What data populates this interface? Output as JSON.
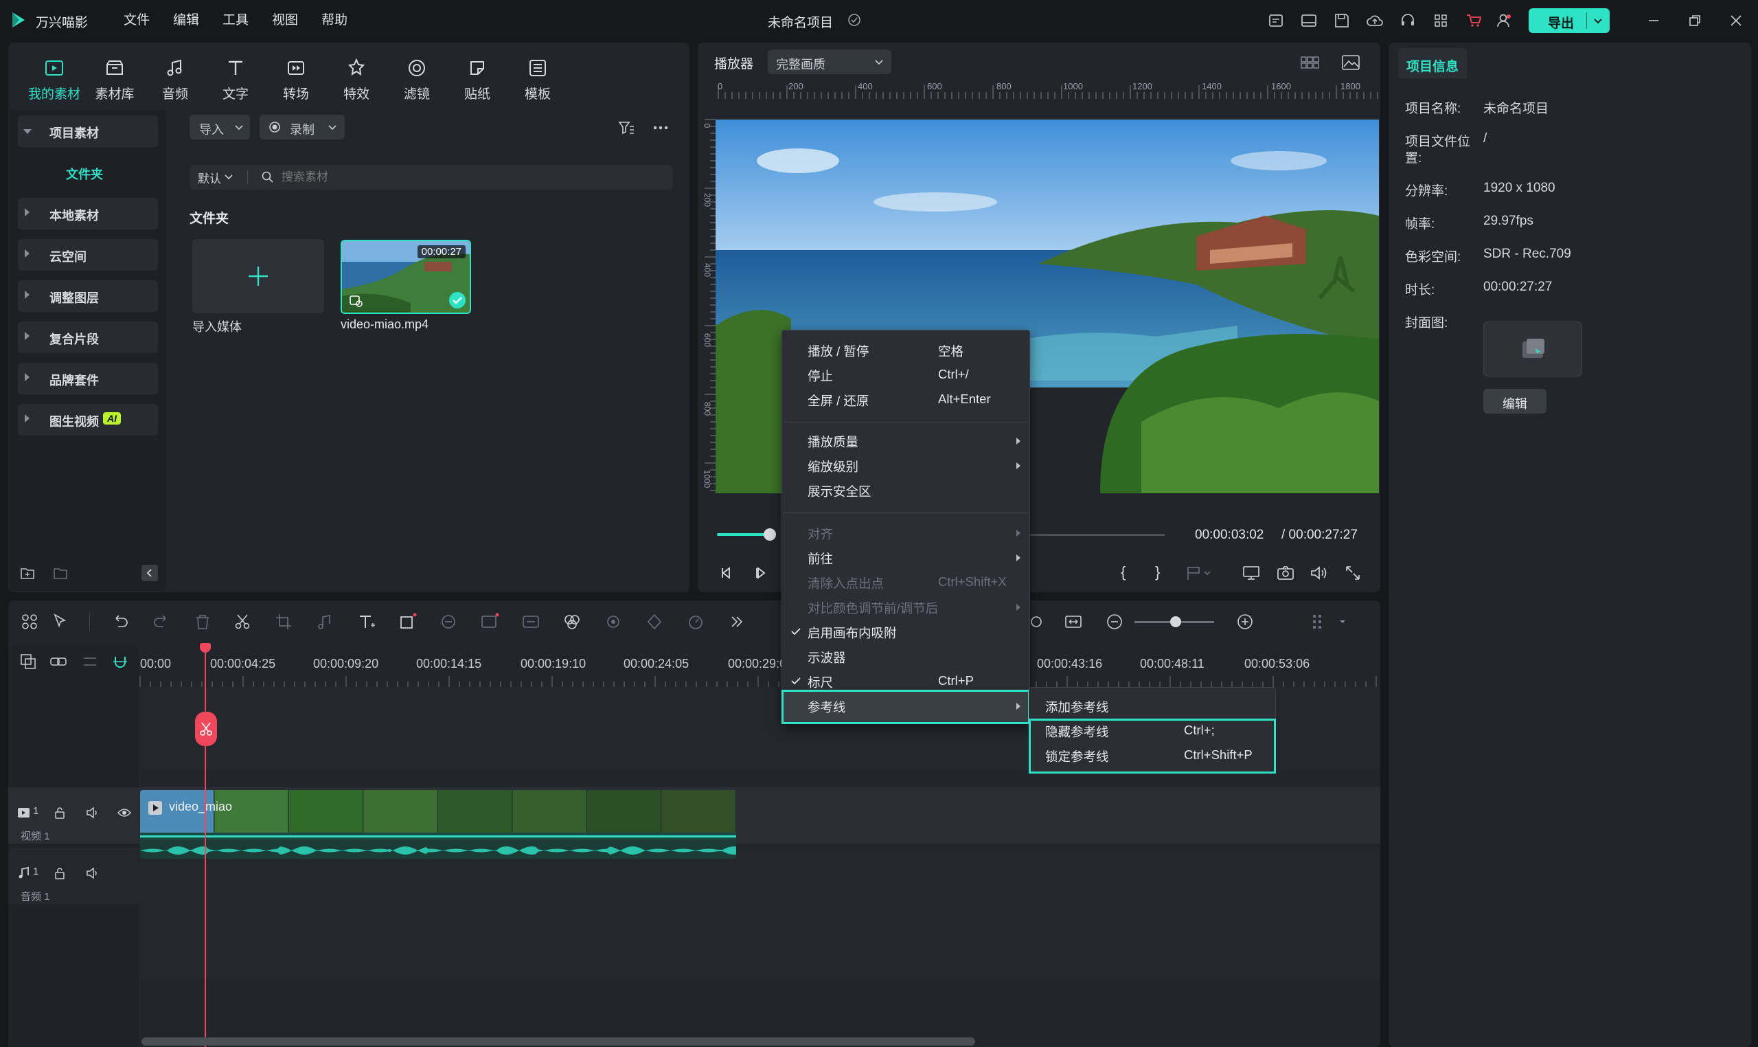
{
  "app": {
    "name": "万兴喵影",
    "project_title": "未命名项目",
    "export_label": "导出"
  },
  "menubar": [
    "文件",
    "编辑",
    "工具",
    "视图",
    "帮助"
  ],
  "toolbar_tabs": [
    {
      "label": "我的素材",
      "icon": "media-icon",
      "active": true
    },
    {
      "label": "素材库",
      "icon": "library-icon"
    },
    {
      "label": "音频",
      "icon": "music-icon"
    },
    {
      "label": "文字",
      "icon": "text-icon"
    },
    {
      "label": "转场",
      "icon": "transition-icon"
    },
    {
      "label": "特效",
      "icon": "effects-icon"
    },
    {
      "label": "滤镜",
      "icon": "filter-icon"
    },
    {
      "label": "贴纸",
      "icon": "sticker-icon"
    },
    {
      "label": "模板",
      "icon": "template-icon"
    }
  ],
  "sidebar": {
    "items": [
      {
        "label": "项目素材",
        "expanded": true
      },
      {
        "label": "文件夹",
        "sub": true
      },
      {
        "label": "本地素材"
      },
      {
        "label": "云空间"
      },
      {
        "label": "调整图层"
      },
      {
        "label": "复合片段"
      },
      {
        "label": "品牌套件"
      },
      {
        "label": "图生视频",
        "badge": "AI"
      }
    ]
  },
  "media": {
    "import_label": "导入",
    "record_label": "录制",
    "sort_label": "默认",
    "search_placeholder": "搜索素材",
    "folder_heading": "文件夹",
    "import_tile_label": "导入媒体",
    "clip_name": "video-miao.mp4",
    "clip_duration": "00:00:27"
  },
  "player": {
    "label": "播放器",
    "quality": "完整画质",
    "ruler_h": [
      "0",
      "200",
      "400",
      "600",
      "800",
      "1000",
      "1200",
      "1400",
      "1600",
      "1800"
    ],
    "ruler_v": [
      "0",
      "200",
      "400",
      "600",
      "800",
      "1000"
    ],
    "current_time": "00:00:03:02",
    "total_time": "/ 00:00:27:27"
  },
  "context_menu": {
    "items": [
      {
        "label": "播放 / 暂停",
        "shortcut": "空格"
      },
      {
        "label": "停止",
        "shortcut": "Ctrl+/"
      },
      {
        "label": "全屏 / 还原",
        "shortcut": "Alt+Enter"
      },
      {
        "label": "播放质量",
        "submenu": true
      },
      {
        "label": "缩放级别",
        "submenu": true
      },
      {
        "label": "展示安全区"
      },
      {
        "label": "对齐",
        "submenu": true,
        "disabled": true
      },
      {
        "label": "前往",
        "submenu": true
      },
      {
        "label": "清除入点出点",
        "shortcut": "Ctrl+Shift+X",
        "disabled": true
      },
      {
        "label": "对比颜色调节前/调节后",
        "submenu": true,
        "disabled": true
      },
      {
        "label": "启用画布内吸附",
        "checked": true
      },
      {
        "label": "示波器"
      },
      {
        "label": "标尺",
        "shortcut": "Ctrl+P",
        "checked": true
      },
      {
        "label": "参考线",
        "submenu": true,
        "highlighted": true
      }
    ],
    "submenu": [
      {
        "label": "添加参考线"
      },
      {
        "label": "隐藏参考线",
        "shortcut": "Ctrl+;"
      },
      {
        "label": "锁定参考线",
        "shortcut": "Ctrl+Shift+P"
      }
    ]
  },
  "project_info": {
    "tab": "项目信息",
    "name_label": "项目名称:",
    "name_value": "未命名项目",
    "path_label_1": "项目文件位",
    "path_label_2": "置:",
    "path_value": "/",
    "resolution_label": "分辨率:",
    "resolution_value": "1920 x 1080",
    "fps_label": "帧率:",
    "fps_value": "29.97fps",
    "color_label": "色彩空间:",
    "color_value": "SDR - Rec.709",
    "duration_label": "时长:",
    "duration_value": "00:00:27:27",
    "cover_label": "封面图:",
    "edit_label": "编辑"
  },
  "timeline": {
    "timecodes": [
      "00:00",
      "00:00:04:25",
      "00:00:09:20",
      "00:00:14:15",
      "00:00:19:10",
      "00:00:24:05",
      "00:00:29:0",
      "00:00:43:16",
      "00:00:48:11",
      "00:00:53:06"
    ],
    "video_track_label": "视频 1",
    "audio_track_label": "音频 1",
    "track_num_video": "1",
    "track_num_audio": "1",
    "clip_label": "video_miao"
  },
  "colors": {
    "accent": "#2ee3c5",
    "playhead": "#f0485a",
    "panel": "#22252b",
    "background": "#16181c"
  }
}
